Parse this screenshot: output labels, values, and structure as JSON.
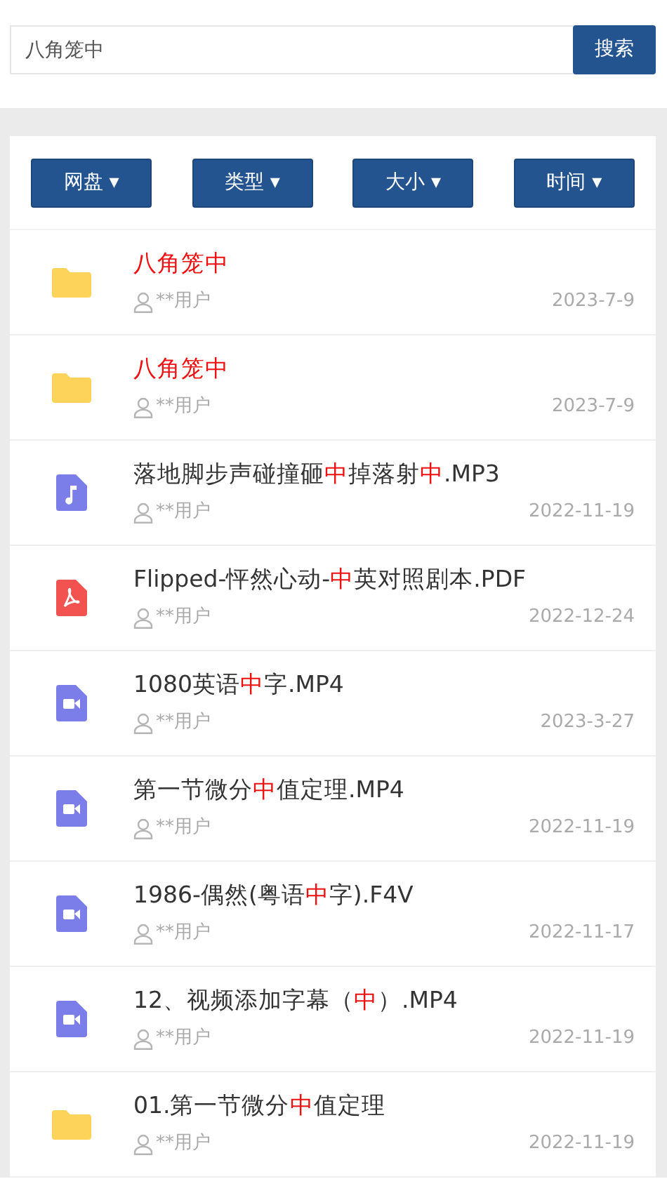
{
  "search": {
    "value": "八角笼中",
    "button": "搜索"
  },
  "filters": [
    {
      "label": "网盘",
      "caret": "▾"
    },
    {
      "label": "类型",
      "caret": "▾"
    },
    {
      "label": "大小",
      "caret": "▾"
    },
    {
      "label": "时间",
      "caret": "▾"
    }
  ],
  "results": [
    {
      "kind": "folder",
      "title": [
        {
          "text": "八角笼中",
          "highlight": true
        }
      ],
      "user": "**用户",
      "date": "2023-7-9"
    },
    {
      "kind": "folder",
      "title": [
        {
          "text": "八角笼中",
          "highlight": true
        }
      ],
      "user": "**用户",
      "date": "2023-7-9"
    },
    {
      "kind": "audio",
      "title": [
        {
          "text": "落地脚步声碰撞砸",
          "highlight": false
        },
        {
          "text": "中",
          "highlight": true
        },
        {
          "text": "掉落射",
          "highlight": false
        },
        {
          "text": "中",
          "highlight": true
        },
        {
          "text": ".MP3",
          "highlight": false
        }
      ],
      "user": "**用户",
      "date": "2022-11-19"
    },
    {
      "kind": "pdf",
      "title": [
        {
          "text": "Flipped-怦然心动-",
          "highlight": false
        },
        {
          "text": "中",
          "highlight": true
        },
        {
          "text": "英对照剧本.PDF",
          "highlight": false
        }
      ],
      "user": "**用户",
      "date": "2022-12-24"
    },
    {
      "kind": "video",
      "title": [
        {
          "text": "1080英语",
          "highlight": false
        },
        {
          "text": "中",
          "highlight": true
        },
        {
          "text": "字.MP4",
          "highlight": false
        }
      ],
      "user": "**用户",
      "date": "2023-3-27"
    },
    {
      "kind": "video",
      "title": [
        {
          "text": "第一节微分",
          "highlight": false
        },
        {
          "text": "中",
          "highlight": true
        },
        {
          "text": "值定理.MP4",
          "highlight": false
        }
      ],
      "user": "**用户",
      "date": "2022-11-19"
    },
    {
      "kind": "video",
      "title": [
        {
          "text": "1986-偶然(粤语",
          "highlight": false
        },
        {
          "text": "中",
          "highlight": true
        },
        {
          "text": "字).F4V",
          "highlight": false
        }
      ],
      "user": "**用户",
      "date": "2022-11-17"
    },
    {
      "kind": "video",
      "title": [
        {
          "text": "12、视频添加字幕（",
          "highlight": false
        },
        {
          "text": "中",
          "highlight": true
        },
        {
          "text": "）.MP4",
          "highlight": false
        }
      ],
      "user": "**用户",
      "date": "2022-11-19"
    },
    {
      "kind": "folder",
      "title": [
        {
          "text": "01.第一节微分",
          "highlight": false
        },
        {
          "text": "中",
          "highlight": true
        },
        {
          "text": "值定理",
          "highlight": false
        }
      ],
      "user": "**用户",
      "date": "2022-11-19"
    }
  ]
}
